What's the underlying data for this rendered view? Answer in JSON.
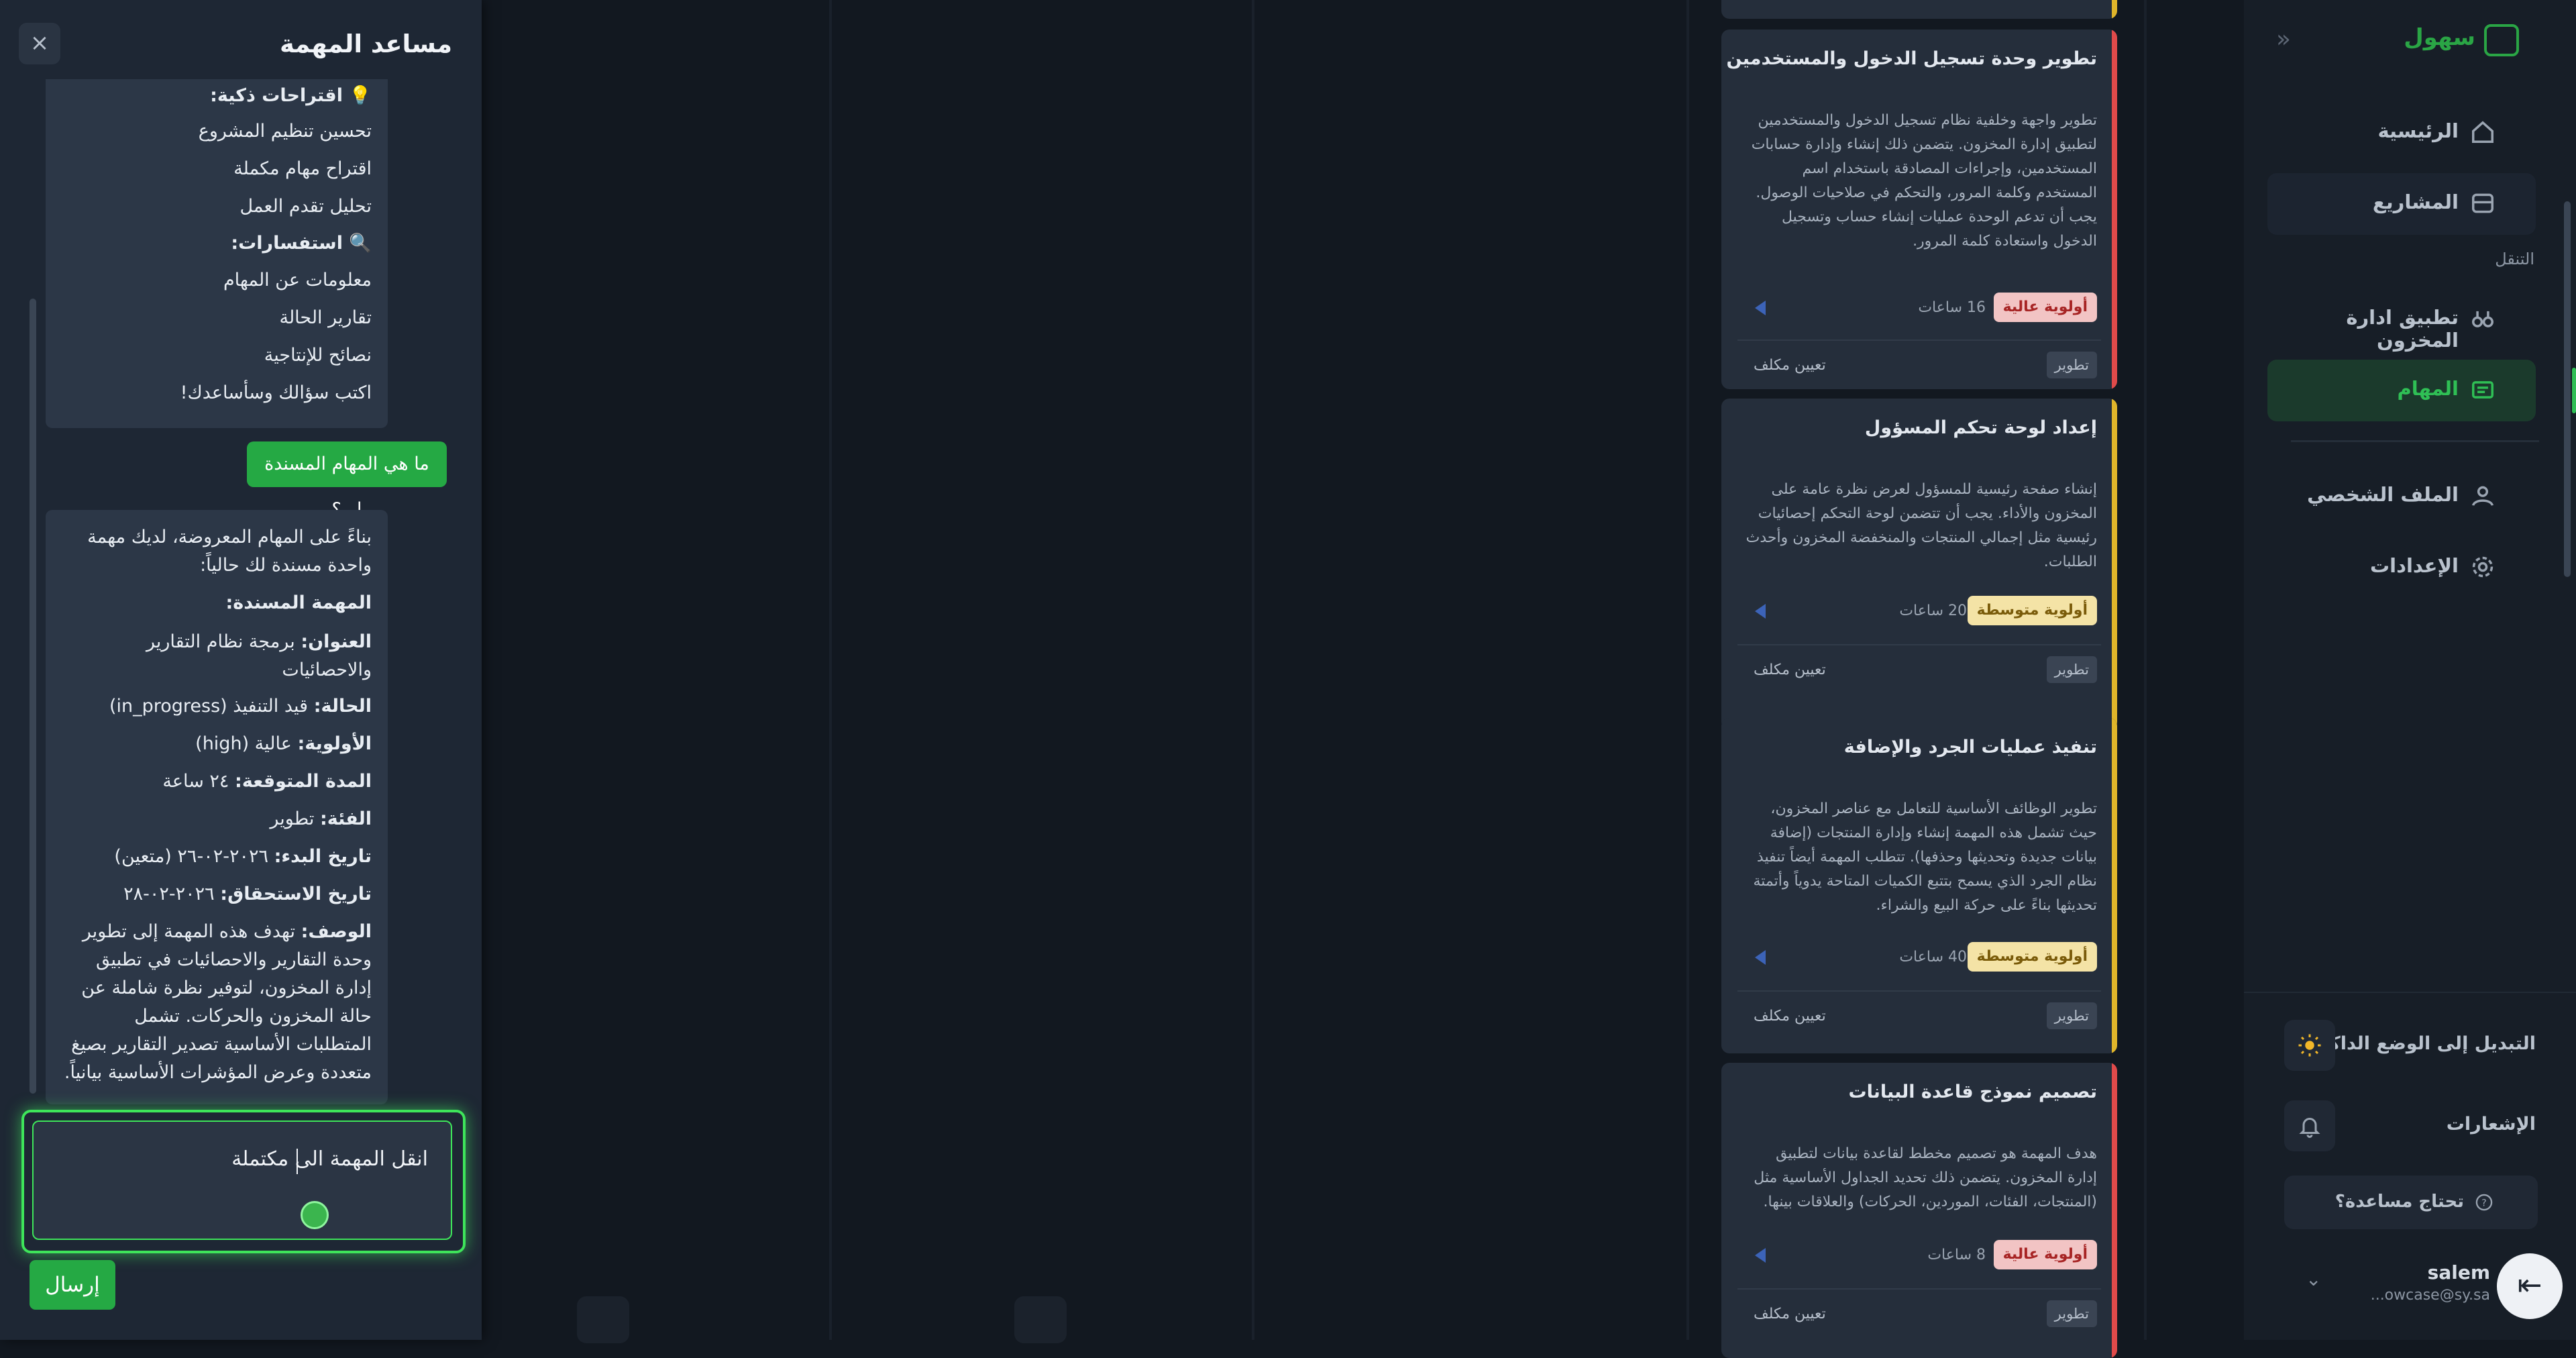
{
  "assistant": {
    "title": "مساعد المهمة",
    "close_icon": "×",
    "smart_header": "💡 اقتراحات ذكية:",
    "smart_items": [
      "تحسين تنظيم المشروع",
      "اقتراح مهام مكملة",
      "تحليل تقدم العمل"
    ],
    "queries_header": "🔍 استفسارات:",
    "query_items": [
      "معلومات عن المهام",
      "تقارير الحالة",
      "نصائح للإنتاجية"
    ],
    "closing": "اكتب سؤالك وسأساعدك!",
    "user_message": "ما هي المهام المسندة لي؟",
    "reply": {
      "intro": "بناءً على المهام المعروضة، لديك مهمة واحدة مسندة لك حالياً:",
      "section": "المهمة المسندة:",
      "title_label": "العنوان:",
      "title_value": "برمجة نظام التقارير والاحصائيات",
      "status_label": "الحالة:",
      "status_value": "قيد التنفيذ (in_progress)",
      "priority_label": "الأولوية:",
      "priority_value": "عالية (high)",
      "duration_label": "المدة المتوقعة:",
      "duration_value": "٢٤ ساعة",
      "category_label": "الفئة:",
      "category_value": "تطوير",
      "start_label": "تاريخ البدء:",
      "start_value": "٢٠٢٦-٠٢-٢٦ (متعين)",
      "due_label": "تاريخ الاستحقاق:",
      "due_value": "٢٠٢٦-٠٢-٢٨",
      "desc_label": "الوصف:",
      "desc_value": "تهدف هذه المهمة إلى تطوير وحدة التقارير والاحصائيات في تطبيق إدارة المخزون، لتوفير نظرة شاملة عن حالة المخزون والحركات. تشمل المتطلبات الأساسية تصدير التقارير بصيغ متعددة وعرض المؤشرات الأساسية بيانياً."
    },
    "input_value": "انقل المهمة الى مكتملة",
    "send_label": "إرسال"
  },
  "cards": [
    {
      "title": "تطوير وحدة تسجيل الدخول والمستخدمين",
      "desc": "تطوير واجهة وخلفية نظام تسجيل الدخول والمستخدمين لتطبيق إدارة المخزون. يتضمن ذلك إنشاء وإدارة حسابات المستخدمين، وإجراءات المصادقة باستخدام اسم المستخدم وكلمة المرور، والتحكم في صلاحيات الوصول. يجب أن تدعم الوحدة عمليات إنشاء حساب وتسجيل الدخول واستعادة كلمة المرور.",
      "priority": "أولوية عالية",
      "hours": "16 ساعات",
      "tag": "تطوير",
      "assign": "تعيين مكلف",
      "color": "#e04a4a"
    },
    {
      "title": "إعداد لوحة تحكم المسؤول",
      "desc": "إنشاء صفحة رئيسية للمسؤول لعرض نظرة عامة على المخزون والأداء. يجب أن تتضمن لوحة التحكم إحصائيات رئيسية مثل إجمالي المنتجات والمنخفضة المخزون وأحدث الطلبات.",
      "priority": "أولوية متوسطة",
      "hours": "20 ساعات",
      "tag": "تطوير",
      "assign": "تعيين مكلف",
      "color": "#e0b52a"
    },
    {
      "title": "تنفيذ عمليات الجرد والإضافة",
      "desc": "تطوير الوظائف الأساسية للتعامل مع عناصر المخزون، حيث تشمل هذه المهمة إنشاء وإدارة المنتجات (إضافة بيانات جديدة وتحديثها وحذفها). تتطلب المهمة أيضاً تنفيذ نظام الجرد الذي يسمح بتتبع الكميات المتاحة يدوياً وأتمتة تحديثها بناءً على حركة البيع والشراء.",
      "priority": "أولوية متوسطة",
      "hours": "40 ساعات",
      "tag": "تطوير",
      "assign": "تعيين مكلف",
      "color": "#e0b52a"
    },
    {
      "title": "تصميم نموذج قاعدة البيانات",
      "desc": "هدف المهمة هو تصميم مخطط لقاعدة بيانات لتطبيق إدارة المخزون. يتضمن ذلك تحديد الجداول الأساسية مثل (المنتجات، الفئات، الموردين، الحركات) والعلاقات بينها.",
      "priority": "أولوية عالية",
      "hours": "8 ساعات",
      "tag": "تطوير",
      "assign": "تعيين مكلف",
      "color": "#e04a4a"
    }
  ],
  "sidebar": {
    "brand": "سهول",
    "home": "الرئيسية",
    "projects": "المشاريع",
    "nav_sub": "التنقل",
    "app": "تطبيق ادارة المخزون",
    "tasks": "المهام",
    "profile": "الملف الشخصي",
    "settings": "الإعدادات",
    "dark_mode": "التبديل إلى الوضع الداكن",
    "notifications": "الإشعارات",
    "help": "تحتاج مساعدة؟",
    "user_name": "salem",
    "user_email": "...owcase@sy.sa"
  }
}
